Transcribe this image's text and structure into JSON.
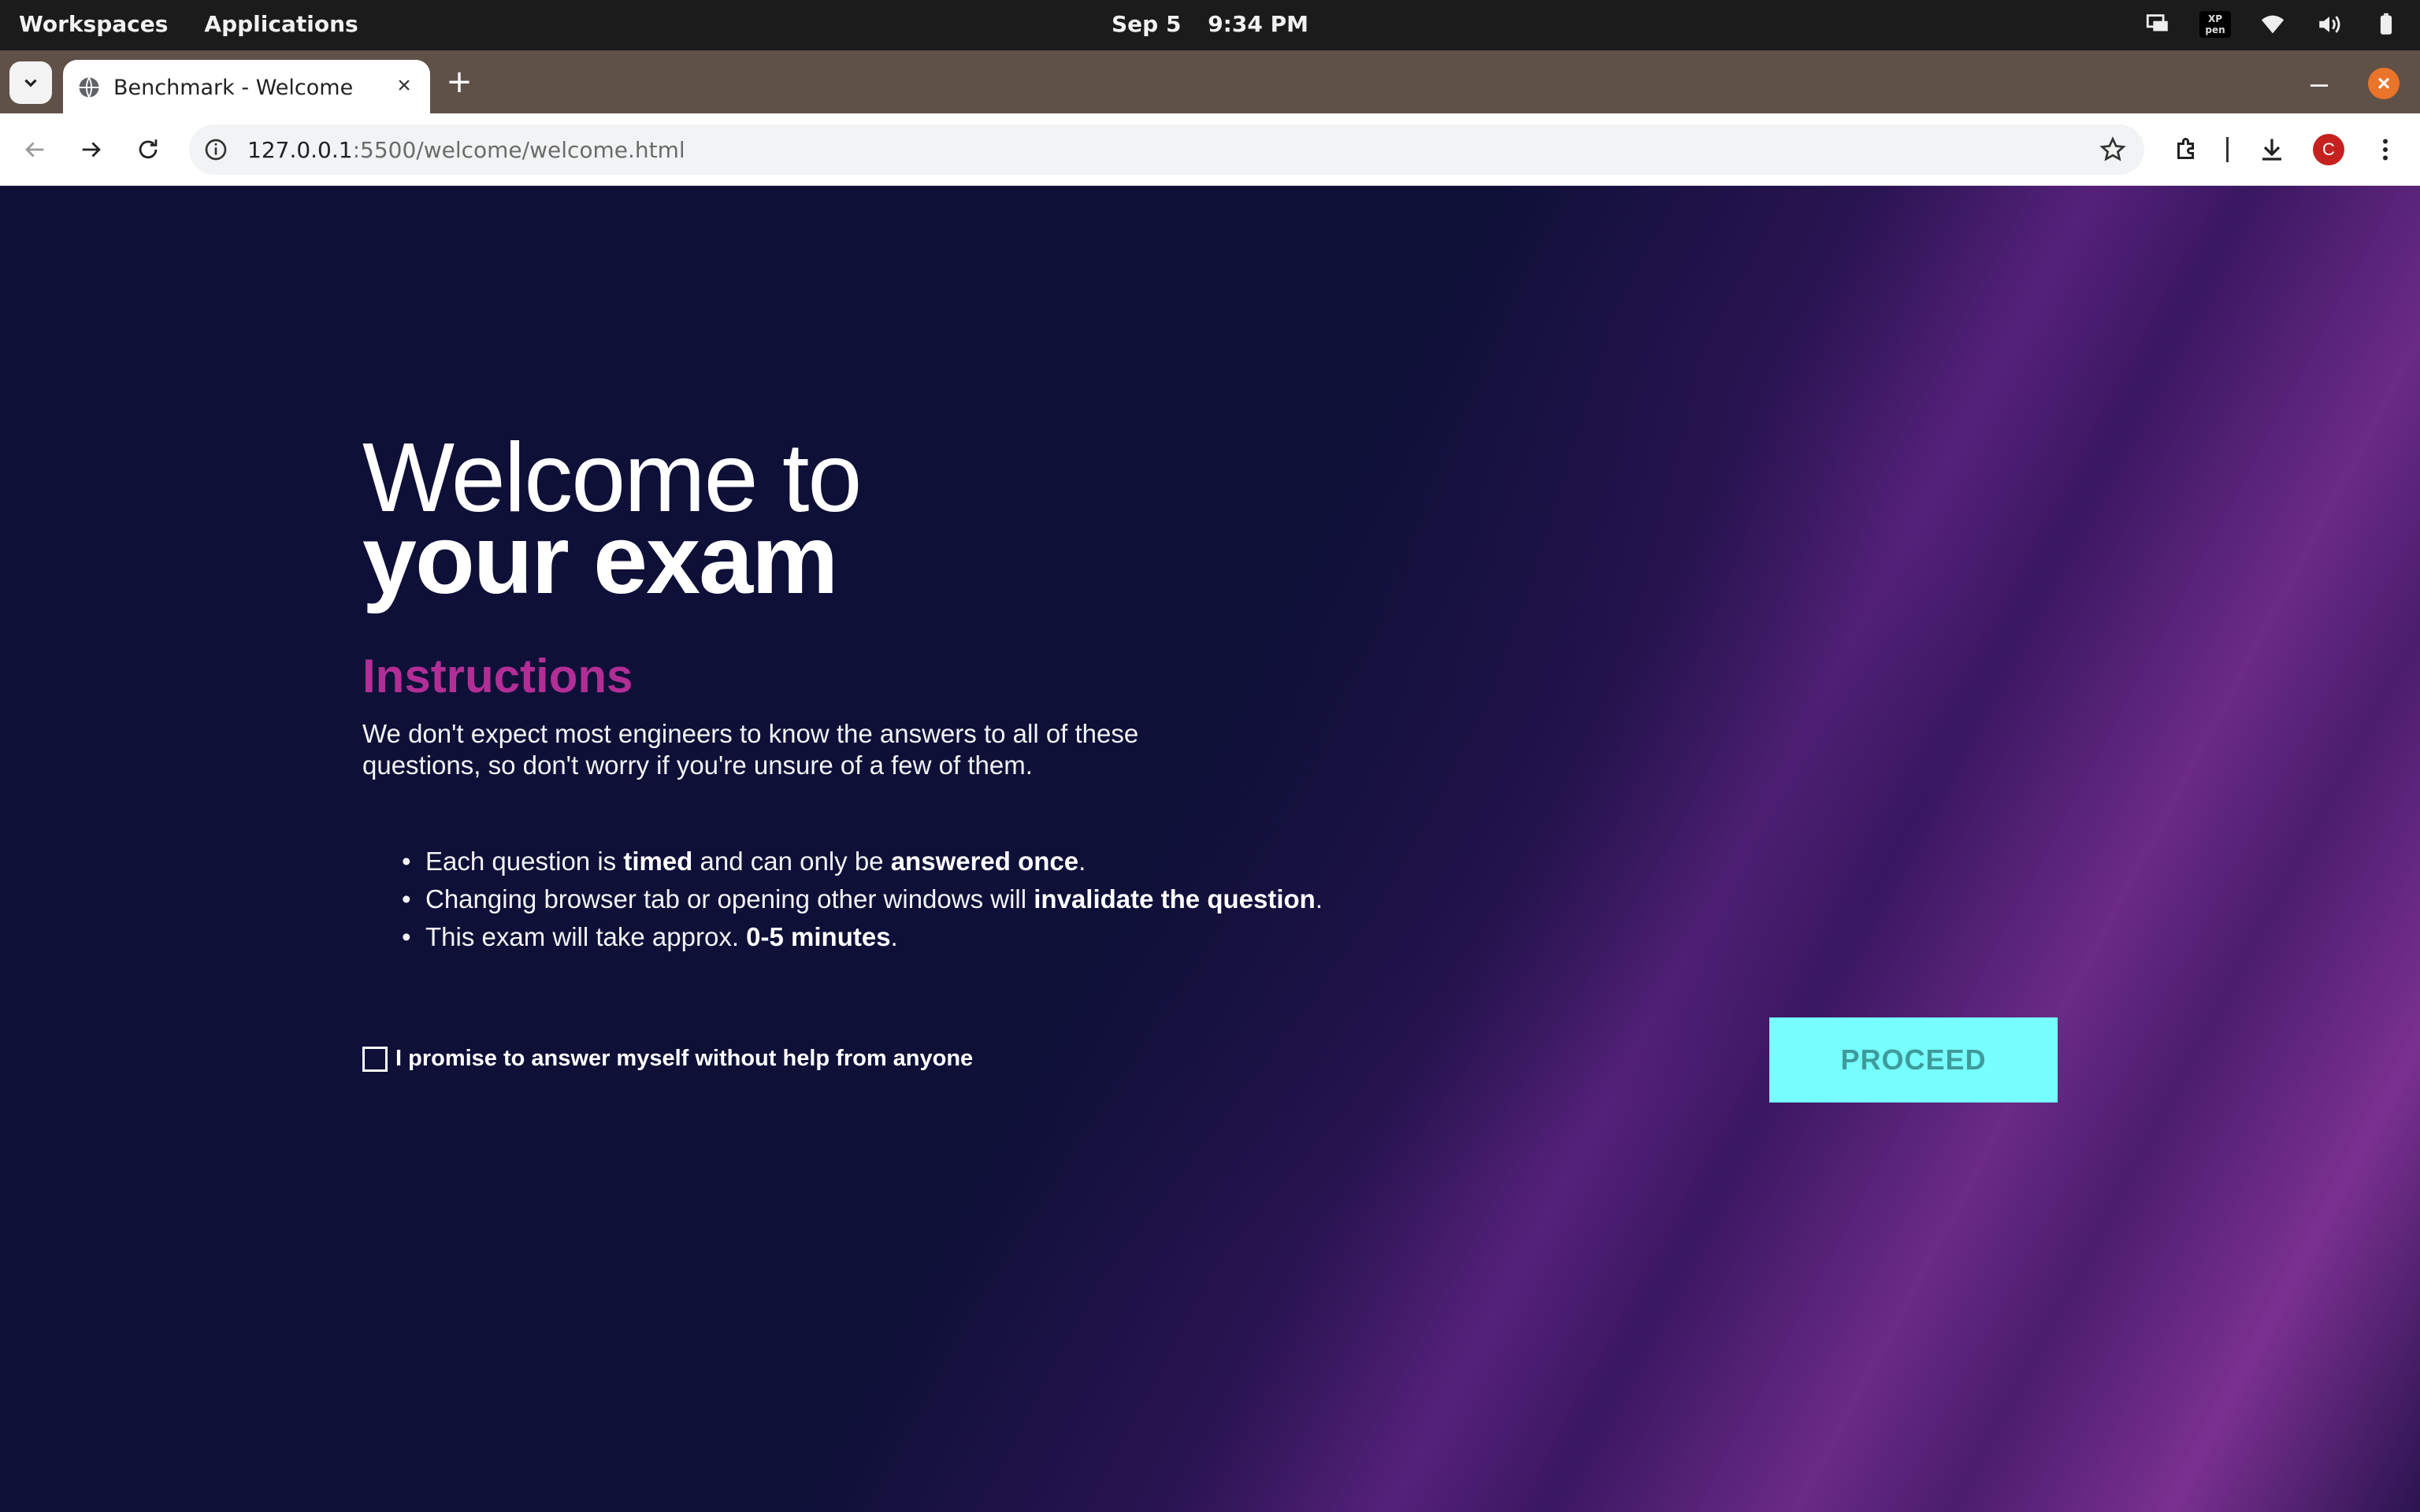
{
  "os": {
    "workspaces": "Workspaces",
    "applications": "Applications",
    "date": "Sep 5",
    "time": "9:34 PM",
    "xp_logo": "XP pen"
  },
  "browser": {
    "tab_title": "Benchmark - Welcome",
    "url_host": "127.0.0.1",
    "url_rest": ":5500/welcome/welcome.html",
    "avatar_letter": "C"
  },
  "page": {
    "heading_line1": "Welcome to",
    "heading_line2": "your exam",
    "instructions_title": "Instructions",
    "intro": "We don't expect most engineers to know the answers to all of these questions, so don't worry if you're unsure of a few of them.",
    "bullets": [
      {
        "pre": "Each question is ",
        "b1": "timed",
        "mid": " and can only be ",
        "b2": "answered once",
        "post": "."
      },
      {
        "pre": "Changing browser tab or opening other windows will ",
        "b1": "invalidate the question",
        "post": "."
      },
      {
        "pre": "This exam will take approx. ",
        "b1": "0-5 minutes",
        "post": "."
      }
    ],
    "promise_label": "I promise to answer myself without help from anyone",
    "proceed_label": "PROCEED"
  },
  "colors": {
    "background": "#0e1038",
    "instructions_accent": "#b22e96",
    "proceed_bg": "#77ffff",
    "proceed_text": "#3f9b9b"
  }
}
